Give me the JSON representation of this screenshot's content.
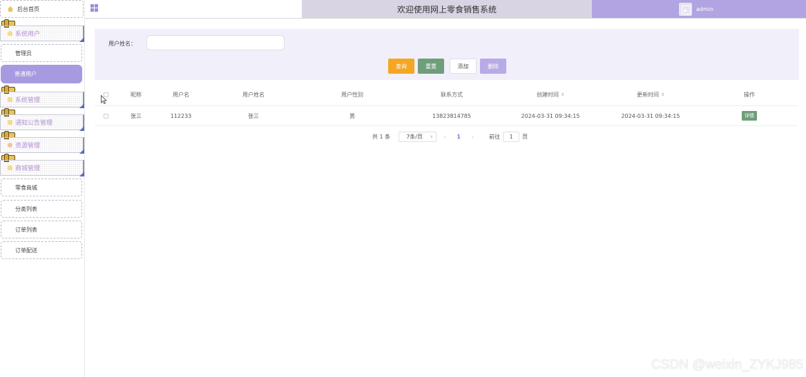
{
  "sidebar": {
    "home_label": "后台首页",
    "groups": [
      {
        "label": "系统用户",
        "items": [
          "管理员",
          "普通用户"
        ]
      },
      {
        "label": "系统管理"
      },
      {
        "label": "通知公告管理"
      },
      {
        "label": "资源管理"
      },
      {
        "label": "商城管理",
        "items": [
          "零食商城",
          "分类列表",
          "订单列表",
          "订单配送"
        ]
      }
    ],
    "active_item": "普通用户"
  },
  "header": {
    "title": "欢迎使用网上零食销售系统",
    "user_name": "admin"
  },
  "search": {
    "label": "用户姓名：",
    "value": "",
    "placeholder": "",
    "buttons": {
      "search": "查询",
      "reset": "重置",
      "add": "添加",
      "delete": "删除"
    }
  },
  "table": {
    "columns": [
      "昵称",
      "用户名",
      "用户姓名",
      "用户性别",
      "联系方式",
      "创建时间",
      "更新时间",
      "操作"
    ],
    "rows": [
      {
        "nickname": "张三",
        "username": "112233",
        "real_name": "张三",
        "gender": "男",
        "phone": "13823814785",
        "created": "2024-03-31 09:34:15",
        "updated": "2024-03-31 09:34:15",
        "action": "详情"
      }
    ]
  },
  "pagination": {
    "total": "共 1 条",
    "page_size": "7条/页",
    "current_page": "1",
    "goto_label": "前往",
    "goto_value": "1",
    "page_unit": "页"
  },
  "watermark": "CSDN @weixin_ZYKJ985",
  "colors": {
    "accent": "#a79ae0",
    "search": "#f5a623",
    "reset": "#6e9e7a",
    "title_bg": "#d8d4e4"
  }
}
